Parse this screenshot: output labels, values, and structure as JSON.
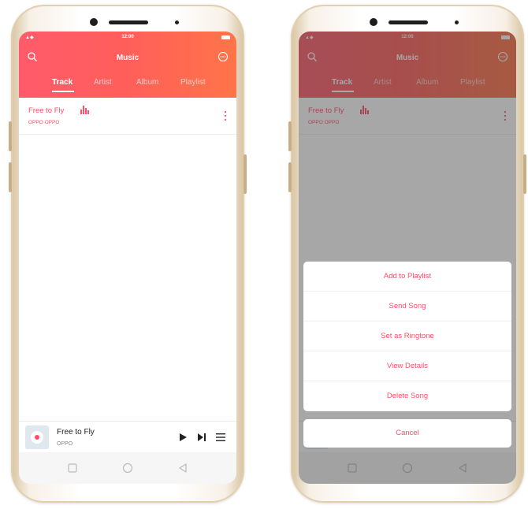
{
  "status": {
    "signal": "",
    "time": "12:00"
  },
  "app": {
    "title": "Music"
  },
  "tabs": [
    {
      "label": "Track",
      "active": true
    },
    {
      "label": "Artist",
      "active": false
    },
    {
      "label": "Album",
      "active": false
    },
    {
      "label": "Playlist",
      "active": false
    }
  ],
  "track": {
    "title": "Free to Fly",
    "artist": "OPPO OPPO"
  },
  "player": {
    "title": "Free to Fly",
    "artist": "OPPO"
  },
  "menu": {
    "items": [
      "Add to Playlist",
      "Send Song",
      "Set as Ringtone",
      "View Details",
      "Delete Song"
    ],
    "cancel": "Cancel"
  },
  "colors": {
    "accent": "#ff4e66",
    "header_start": "#ff5b6c",
    "header_end": "#ff7449"
  },
  "icons": [
    "search-icon",
    "more-icon",
    "equalizer-icon",
    "overflow-menu-icon",
    "play-icon",
    "next-icon",
    "queue-icon",
    "square-nav-icon",
    "circle-nav-icon",
    "triangle-nav-icon"
  ]
}
